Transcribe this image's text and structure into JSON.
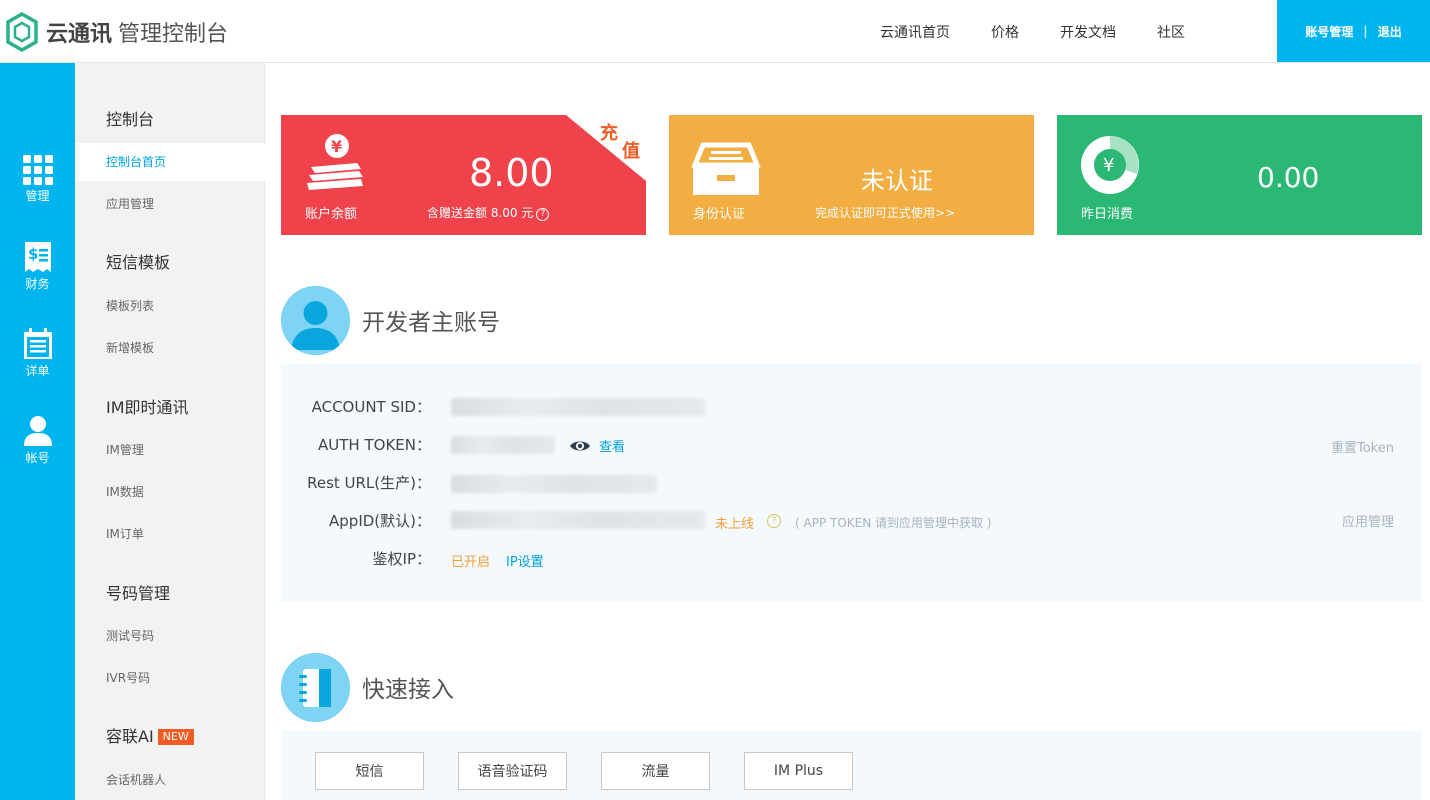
{
  "header": {
    "brand": "云通讯",
    "subtitle": "管理控制台",
    "nav": [
      "云通讯首页",
      "价格",
      "开发文档",
      "社区"
    ],
    "account_manage": "账号管理",
    "logout": "退出",
    "accent": "#00b4ef"
  },
  "rail": [
    {
      "label": "管理",
      "icon": "grid-icon",
      "active": true
    },
    {
      "label": "财务",
      "icon": "invoice-icon",
      "active": false
    },
    {
      "label": "详单",
      "icon": "calendar-list-icon",
      "active": false
    },
    {
      "label": "帐号",
      "icon": "user-icon",
      "active": false
    }
  ],
  "sidebar": {
    "groups": [
      {
        "title": "控制台",
        "items": [
          "控制台首页",
          "应用管理"
        ]
      },
      {
        "title": "短信模板",
        "items": [
          "模板列表",
          "新增模板"
        ]
      },
      {
        "title": "IM即时通讯",
        "items": [
          "IM管理",
          "IM数据",
          "IM订单"
        ]
      },
      {
        "title": "号码管理",
        "items": [
          "测试号码",
          "IVR号码"
        ]
      },
      {
        "title": "容联AI",
        "badge": "NEW",
        "items": [
          "会话机器人"
        ]
      }
    ],
    "active_item": "控制台首页"
  },
  "cards": {
    "balance": {
      "caption": "账户余额",
      "value": "8.00",
      "gift_text": "含赠送金额 8.00 元",
      "help": "?",
      "ribbon_1": "充",
      "ribbon_2": "值",
      "color": "#f0424a"
    },
    "identity": {
      "caption": "身份认证",
      "status": "未认证",
      "action": "完成认证即可正式使用>>",
      "color": "#f2ae42"
    },
    "yesterday": {
      "caption": "昨日消费",
      "value": "0.00",
      "color": "#2bb774"
    }
  },
  "developer": {
    "title": "开发者主账号",
    "account_sid_label": "ACCOUNT SID：",
    "auth_token_label": "AUTH TOKEN：",
    "view_label": "查看",
    "reset_token": "重置Token",
    "rest_url_label": "Rest URL(生产)：",
    "appid_label": "AppID(默认)：",
    "appid_status": "未上线",
    "appid_help": "?",
    "appid_note": "( APP TOKEN 请到应用管理中获取 )",
    "app_manage": "应用管理",
    "auth_ip_label": "鉴权IP：",
    "auth_ip_status": "已开启",
    "ip_settings": "IP设置"
  },
  "quick": {
    "title": "快速接入",
    "buttons": [
      "短信",
      "语音验证码",
      "流量",
      "IM Plus"
    ]
  }
}
